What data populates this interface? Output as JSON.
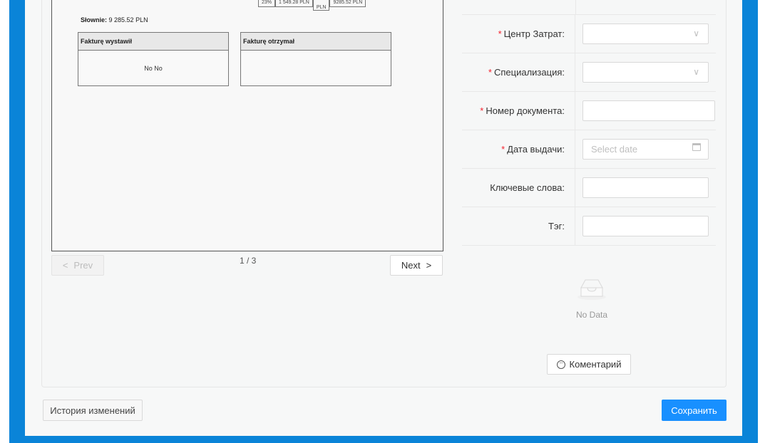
{
  "document": {
    "top_cells": [
      "23%",
      "1 549.28 PLN",
      "PLN",
      "9285.52 PLN"
    ],
    "slownie_label": "Słownie:",
    "slownie_value": "9 285.52 PLN",
    "issued_by_label": "Fakturę wystawił",
    "issued_by_value": "No No",
    "received_by_label": "Fakturę otrzymał"
  },
  "pagination": {
    "prev": "Prev",
    "next": "Next",
    "page": "1 / 3"
  },
  "form": {
    "cost_center_label": "Центр Затрат",
    "specialization_label": "Специализация",
    "doc_number_label": "Номер документа",
    "issue_date_label": "Дата выдачи",
    "issue_date_placeholder": "Select date",
    "keywords_label": "Ключевые слова",
    "tag_label": "Тэг"
  },
  "comments": {
    "empty_text": "No Data",
    "comment_button": "Коментарий"
  },
  "footer": {
    "history_button": "История изменений",
    "save_button": "Сохранить"
  },
  "colors": {
    "accent": "#1890ff",
    "frame": "#0a84d8",
    "required": "#f5222d"
  }
}
